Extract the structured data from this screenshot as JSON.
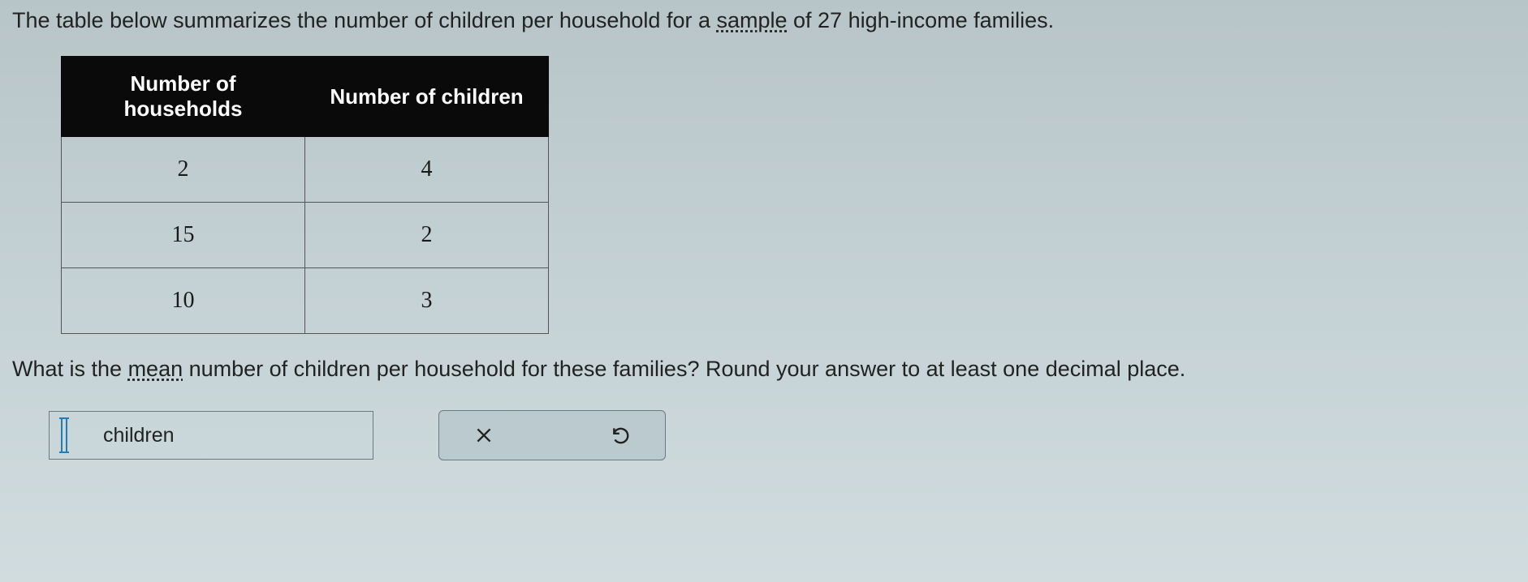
{
  "intro": {
    "pre": "The table below summarizes the number of children per household for a ",
    "keyword": "sample",
    "post": " of 27 high-income families."
  },
  "table": {
    "headers": [
      "Number of households",
      "Number of children"
    ],
    "rows": [
      {
        "households": "2",
        "children": "4"
      },
      {
        "households": "15",
        "children": "2"
      },
      {
        "households": "10",
        "children": "3"
      }
    ]
  },
  "question": {
    "pre": "What is the ",
    "keyword": "mean",
    "post": " number of children per household for these families? Round your answer to at least one decimal place."
  },
  "answer": {
    "value": "",
    "unit": "children"
  },
  "chart_data": {
    "type": "table",
    "title": "Number of children per household (sample of 27 high-income families)",
    "columns": [
      "Number of households",
      "Number of children"
    ],
    "rows": [
      [
        2,
        4
      ],
      [
        15,
        2
      ],
      [
        10,
        3
      ]
    ]
  }
}
